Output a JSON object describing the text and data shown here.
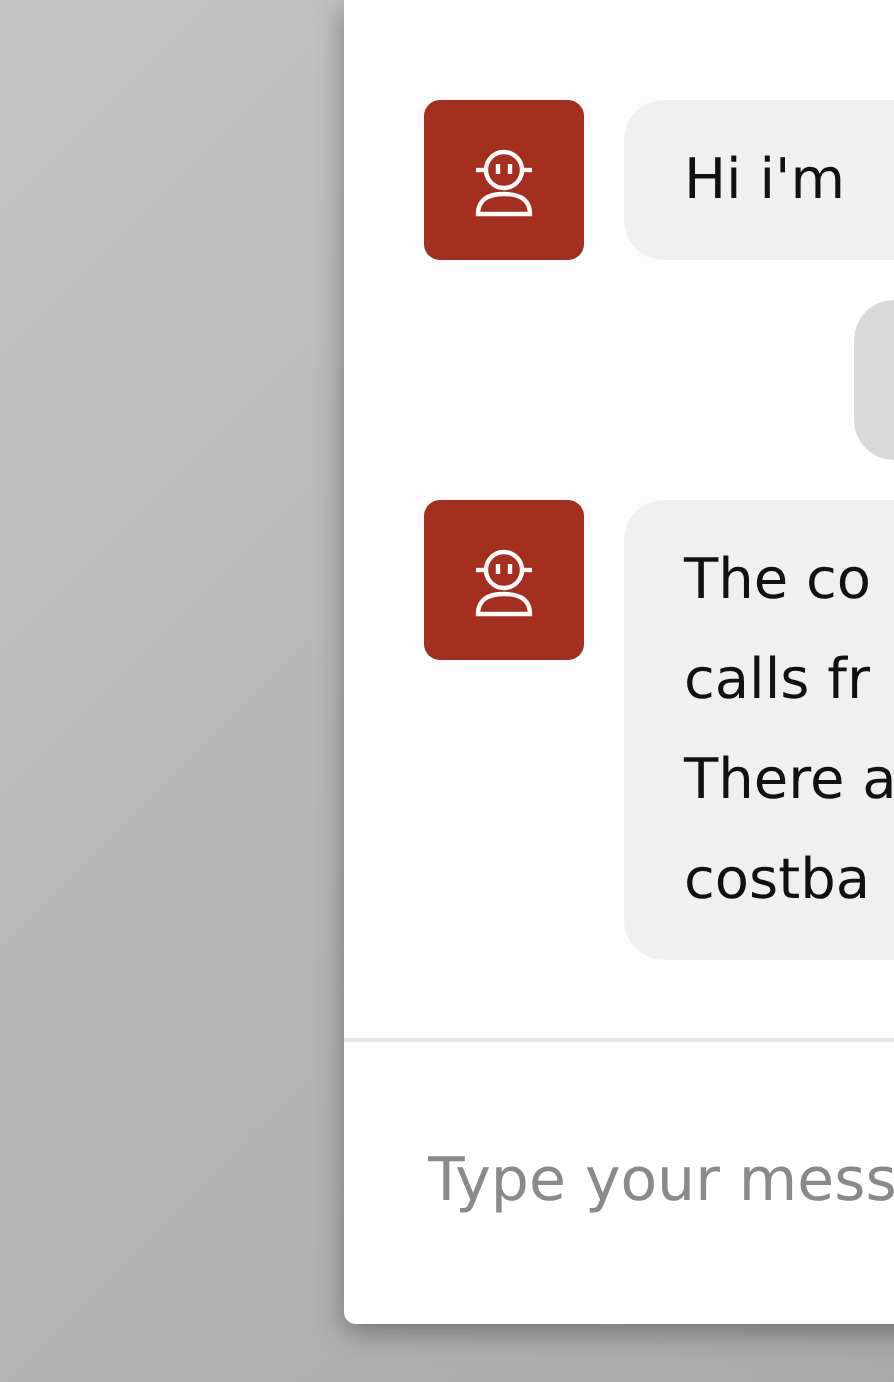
{
  "messages": [
    {
      "kind": "bot",
      "text": "Hi i'm"
    },
    {
      "kind": "user"
    },
    {
      "kind": "bot",
      "text": "The co\ncalls fr\nThere a\ncostba"
    }
  ],
  "composer": {
    "placeholder": "Type your mess"
  }
}
